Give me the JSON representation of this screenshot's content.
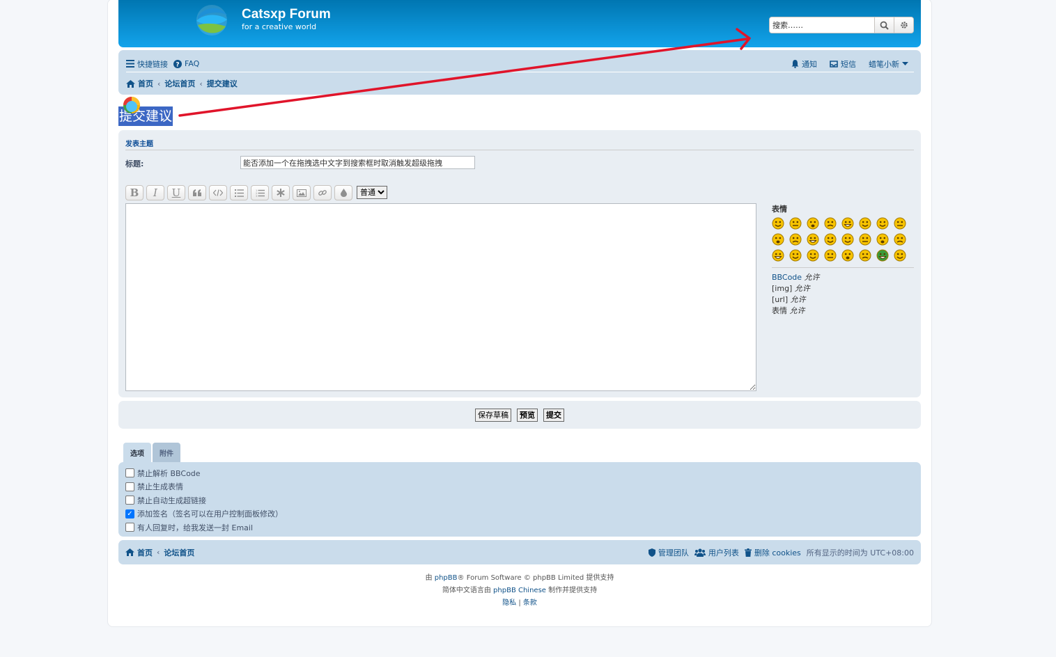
{
  "header": {
    "site_title": "Catsxp Forum",
    "site_desc": "for a creative world",
    "search_placeholder": "搜索……"
  },
  "nav": {
    "quick_links": "快捷链接",
    "faq": "FAQ",
    "notifications": "通知",
    "messages": "短信",
    "username": "蜡笔小新",
    "crumb_home": "首页",
    "crumb_forum": "论坛首页",
    "crumb_page": "提交建议"
  },
  "page_title": "提交建议",
  "post": {
    "section_title": "发表主题",
    "subject_label": "标题:",
    "subject_value": "能否添加一个在拖拽选中文字到搜索框时取消触发超级拖拽",
    "font_size_selected": "普通",
    "toolbar_labels": {
      "bold": "B",
      "italic": "I",
      "underline": "U"
    }
  },
  "smilies": {
    "title": "表情",
    "count": 24,
    "face_color": "#f7c300"
  },
  "permissions": {
    "bbcode": "BBCode",
    "bbcode_state": "允许",
    "img": "[img]",
    "img_state": "允许",
    "url": "[url]",
    "url_state": "允许",
    "smilies": "表情",
    "smilies_state": "允许"
  },
  "buttons": {
    "save_draft": "保存草稿",
    "preview": "预览",
    "submit": "提交"
  },
  "tabs": {
    "options": "选项",
    "attachments": "附件"
  },
  "options": [
    {
      "label": "禁止解析 BBCode",
      "checked": false
    },
    {
      "label": "禁止生成表情",
      "checked": false
    },
    {
      "label": "禁止自动生成超链接",
      "checked": false
    },
    {
      "label": "添加签名（签名可以在用户控制面板修改）",
      "checked": true
    },
    {
      "label": "有人回复时，给我发送一封 Email",
      "checked": false
    }
  ],
  "footer": {
    "crumb_home": "首页",
    "crumb_forum": "论坛首页",
    "team": "管理团队",
    "members": "用户列表",
    "delete_cookies": "删除 cookies",
    "timezone": "所有显示的时间为 UTC+08:00",
    "powered_prefix": "由",
    "phpbb": "phpBB",
    "powered_suffix": "® Forum Software © phpBB Limited 提供支持",
    "chinese_prefix": "简体中文语言由",
    "phpbb_chinese": "phpBB Chinese",
    "chinese_suffix": "制作并提供支持",
    "privacy": "隐私",
    "pipe": "|",
    "terms": "条款"
  },
  "colors": {
    "header_gradient_top": "#0076b1",
    "header_gradient_bottom": "#12a3eb",
    "nav_bg": "#cadceb",
    "link": "#105289",
    "annotation_arrow": "#e0142a",
    "title_highlight": "#3c67c4"
  }
}
